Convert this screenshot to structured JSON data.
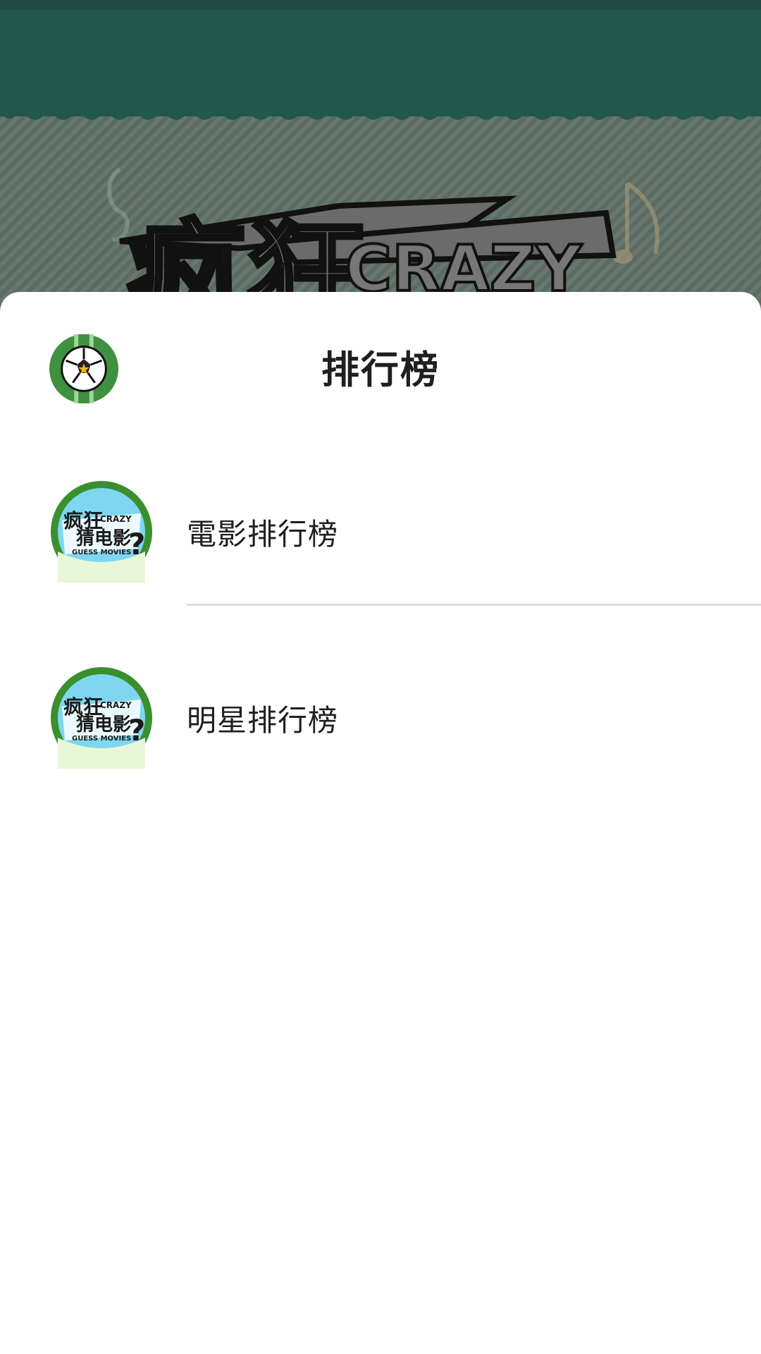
{
  "background": {
    "header_color": "#22574e",
    "art_text": "疯狂",
    "art_subtext": "CRAZY"
  },
  "sheet": {
    "title": "排行榜",
    "icon": "soccer-ball-icon"
  },
  "items": [
    {
      "label": "電影排行榜",
      "icon": "crazy-guess-movies-app-icon",
      "icon_text": "疯狂",
      "icon_subtext": "猜电影",
      "icon_en": "CRAZY",
      "icon_en2": "GUESS MOVIES"
    },
    {
      "label": "明星排行榜",
      "icon": "crazy-guess-movies-app-icon",
      "icon_text": "疯狂",
      "icon_subtext": "猜电影",
      "icon_en": "CRAZY",
      "icon_en2": "GUESS MOVIES"
    }
  ],
  "colors": {
    "accent_green": "#3e9a3a",
    "divider": "#dddddd"
  }
}
